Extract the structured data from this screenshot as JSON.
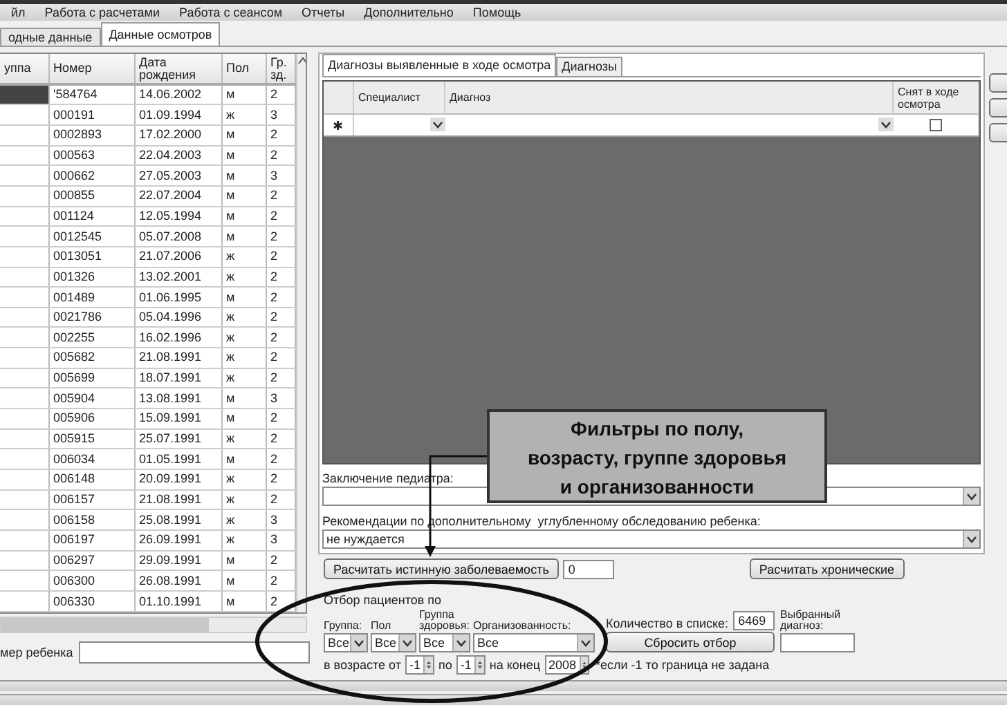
{
  "menu": [
    {
      "label": "йл"
    },
    {
      "label": "Работа с расчетами"
    },
    {
      "label": "Работа с сеансом"
    },
    {
      "label": "Отчеты"
    },
    {
      "label": "Дополнительно"
    },
    {
      "label": "Помощь"
    }
  ],
  "tabs": [
    {
      "label": "одные данные",
      "selected": false
    },
    {
      "label": "Данные осмотров",
      "selected": true
    }
  ],
  "grid": {
    "columns": [
      "уппа",
      "Номер",
      "Дата рождения",
      "Пол",
      "Гр. зд."
    ],
    "rows": [
      {
        "selected": true,
        "cells": [
          "",
          "'584764",
          "14.06.2002",
          "м",
          "2"
        ]
      },
      {
        "selected": false,
        "cells": [
          "",
          "000191",
          "01.09.1994",
          "ж",
          "3"
        ]
      },
      {
        "selected": false,
        "cells": [
          "",
          "0002893",
          "17.02.2000",
          "м",
          "2"
        ]
      },
      {
        "selected": false,
        "cells": [
          "",
          "000563",
          "22.04.2003",
          "м",
          "2"
        ]
      },
      {
        "selected": false,
        "cells": [
          "",
          "000662",
          "27.05.2003",
          "м",
          "3"
        ]
      },
      {
        "selected": false,
        "cells": [
          "",
          "000855",
          "22.07.2004",
          "м",
          "2"
        ]
      },
      {
        "selected": false,
        "cells": [
          "",
          "001124",
          "12.05.1994",
          "м",
          "2"
        ]
      },
      {
        "selected": false,
        "cells": [
          "",
          "0012545",
          "05.07.2008",
          "м",
          "2"
        ]
      },
      {
        "selected": false,
        "cells": [
          "",
          "0013051",
          "21.07.2006",
          "ж",
          "2"
        ]
      },
      {
        "selected": false,
        "cells": [
          "",
          "001326",
          "13.02.2001",
          "ж",
          "2"
        ]
      },
      {
        "selected": false,
        "cells": [
          "",
          "001489",
          "01.06.1995",
          "м",
          "2"
        ]
      },
      {
        "selected": false,
        "cells": [
          "",
          "0021786",
          "05.04.1996",
          "ж",
          "2"
        ]
      },
      {
        "selected": false,
        "cells": [
          "",
          "002255",
          "16.02.1996",
          "ж",
          "2"
        ]
      },
      {
        "selected": false,
        "cells": [
          "",
          "005682",
          "21.08.1991",
          "ж",
          "2"
        ]
      },
      {
        "selected": false,
        "cells": [
          "",
          "005699",
          "18.07.1991",
          "ж",
          "2"
        ]
      },
      {
        "selected": false,
        "cells": [
          "",
          "005904",
          "13.08.1991",
          "м",
          "3"
        ]
      },
      {
        "selected": false,
        "cells": [
          "",
          "005906",
          "15.09.1991",
          "м",
          "2"
        ]
      },
      {
        "selected": false,
        "cells": [
          "",
          "005915",
          "25.07.1991",
          "ж",
          "2"
        ]
      },
      {
        "selected": false,
        "cells": [
          "",
          "006034",
          "01.05.1991",
          "м",
          "2"
        ]
      },
      {
        "selected": false,
        "cells": [
          "",
          "006148",
          "20.09.1991",
          "ж",
          "2"
        ]
      },
      {
        "selected": false,
        "cells": [
          "",
          "006157",
          "21.08.1991",
          "ж",
          "2"
        ]
      },
      {
        "selected": false,
        "cells": [
          "",
          "006158",
          "25.08.1991",
          "ж",
          "3"
        ]
      },
      {
        "selected": false,
        "cells": [
          "",
          "006197",
          "26.09.1991",
          "ж",
          "3"
        ]
      },
      {
        "selected": false,
        "cells": [
          "",
          "006297",
          "29.09.1991",
          "м",
          "2"
        ]
      },
      {
        "selected": false,
        "cells": [
          "",
          "006300",
          "26.08.1991",
          "м",
          "2"
        ]
      },
      {
        "selected": false,
        "cells": [
          "",
          "006330",
          "01.10.1991",
          "м",
          "2"
        ]
      }
    ]
  },
  "child_number": {
    "label": "мер ребенка"
  },
  "diagnosis_panel": {
    "tabs": [
      {
        "label": "Диагнозы выявленные в ходе осмотра",
        "selected": true
      },
      {
        "label": "Диагнозы",
        "selected": false
      }
    ],
    "columns": [
      "Специалист",
      "Диагноз",
      "Снят в ходе осмотра"
    ],
    "new_row": {
      "marker": "✱",
      "removed": false
    }
  },
  "pediatrician_conclusion": {
    "label": "Заключение педиатра:"
  },
  "recommendations": {
    "label": "Рекомендации по дополнительному  углубленному обследованию ребенка:",
    "value": "не нуждается"
  },
  "actions": {
    "calc_button": "Расчитать истинную заболеваемость",
    "calc_value": "0",
    "chronic_button": "Расчитать хронические"
  },
  "filters": {
    "title": "Отбор пациентов по",
    "fields": [
      {
        "label": "Группа:",
        "value": "Все"
      },
      {
        "label": "Пол",
        "value": "Все"
      },
      {
        "label": "Группа здоровья:",
        "value": "Все"
      },
      {
        "label": "Организованность:",
        "value": "Все"
      }
    ],
    "count_label": "Количество в списке:",
    "count": "6469",
    "reset_button": "Сбросить отбор",
    "diagnosis_label": "Выбранный диагноз:",
    "age_from_label": "в возрасте от",
    "age_from": "-1",
    "age_to_label": "по",
    "age_to": "-1",
    "year_label": "на конец",
    "year": "2008",
    "note": "*если -1 то граница не задана"
  },
  "annotation": {
    "lines": [
      "Фильтры по полу,",
      "возрасту, группе здоровья",
      "и организованности"
    ]
  }
}
